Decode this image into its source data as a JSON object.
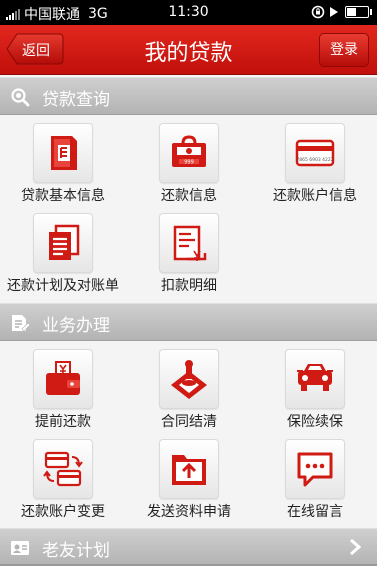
{
  "status_bar": {
    "carrier": "中国联通",
    "network": "3G",
    "time": "11:30"
  },
  "header": {
    "back_label": "返回",
    "title": "我的贷款",
    "login_label": "登录"
  },
  "sections": {
    "loan_query": {
      "title": "贷款查询",
      "items": [
        "贷款基本信息",
        "还款信息",
        "还款账户信息",
        "还款计划及对账单",
        "扣款明细"
      ]
    },
    "business": {
      "title": "业务办理",
      "items": [
        "提前还款",
        "合同结清",
        "保险续保",
        "还款账户变更",
        "发送资料申请",
        "在线留言"
      ]
    },
    "friends": {
      "title": "老友计划"
    }
  },
  "icon_text": {
    "money_amount": "999",
    "card_number": "7865 6903 4222"
  },
  "icons": {
    "loan_query": [
      "loan-info-icon",
      "repayment-info-icon",
      "bank-card-icon",
      "repayment-plan-icon",
      "deduction-detail-icon"
    ],
    "business": [
      "wallet-icon",
      "contract-stamp-icon",
      "car-insurance-icon",
      "account-change-icon",
      "upload-document-icon",
      "message-icon"
    ]
  },
  "colors": {
    "accent": "#c8140f",
    "header_bar": "#bdbdbd",
    "background": "#f4f4f4"
  }
}
